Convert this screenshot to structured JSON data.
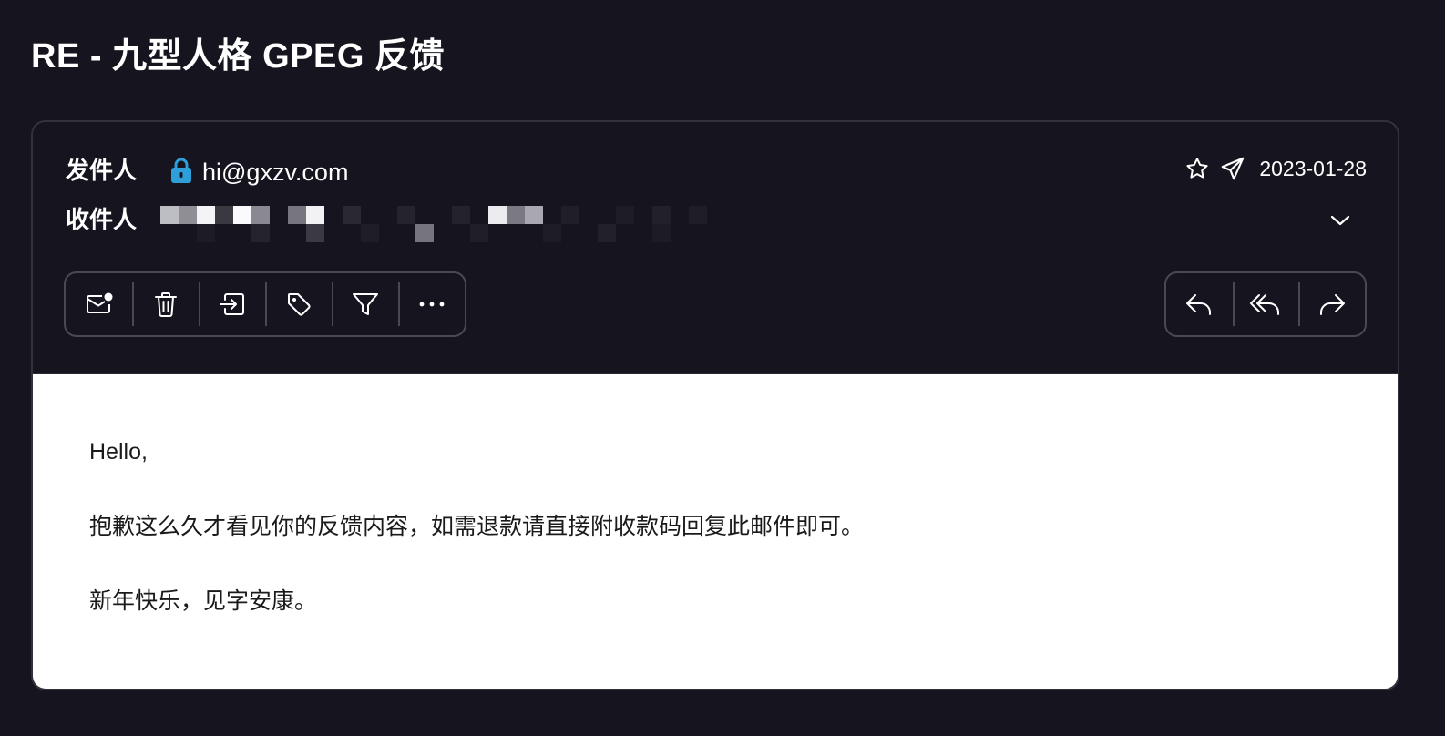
{
  "email": {
    "subject": "RE - 九型人格 GPEG 反馈",
    "from_label": "发件人",
    "from_address": "hi@gxzv.com",
    "to_label": "收件人",
    "date": "2023-01-28",
    "body": {
      "greeting": "Hello,",
      "paragraph": "抱歉这么久才看见你的反馈内容，如需退款请直接附收款码回复此邮件即可。",
      "closing": "新年快乐，见字安康。"
    }
  },
  "toolbar": {
    "left_icons": [
      "mark-unread-icon",
      "trash-icon",
      "move-to-icon",
      "tag-icon",
      "filter-icon",
      "more-icon"
    ],
    "right_icons": [
      "reply-icon",
      "reply-all-icon",
      "forward-icon"
    ]
  },
  "colors": {
    "background": "#16151f",
    "border": "#4a4953",
    "lock_accent": "#2e9fd8",
    "body_background": "#ffffff"
  }
}
